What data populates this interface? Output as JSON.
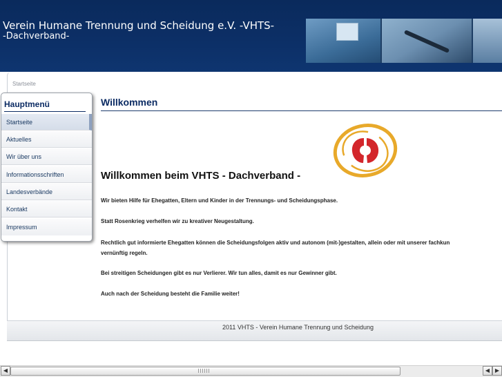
{
  "header": {
    "title": "Verein Humane Trennung und Scheidung e.V. -VHTS-",
    "subtitle": "-Dachverband-"
  },
  "breadcrumb": "Startseite",
  "sidebar": {
    "title": "Hauptmenü",
    "items": [
      {
        "label": "Startseite",
        "active": true
      },
      {
        "label": "Aktuelles"
      },
      {
        "label": "Wir über uns"
      },
      {
        "label": "Informationsschriften"
      },
      {
        "label": "Landesverbände"
      },
      {
        "label": "Kontakt"
      },
      {
        "label": "Impressum"
      }
    ]
  },
  "main": {
    "heading": "Willkommen",
    "welcome": "Willkommen beim VHTS - Dachverband -",
    "paragraphs": [
      "Wir bieten Hilfe für Ehegatten, Eltern und Kinder in der Trennungs- und Scheidungsphase.",
      "Statt Rosenkrieg verhelfen wir zu kreativer Neugestaltung.",
      "Rechtlich gut informierte Ehegatten können die Scheidungsfolgen aktiv und autonom (mit-)gestalten, allein oder mit unserer fachkun",
      "vernünftig regeln.",
      "Bei streitigen Scheidungen gibt es nur Verlierer. Wir tun alles, damit es nur Gewinner gibt.",
      "Auch nach der Scheidung besteht die Familie weiter!"
    ]
  },
  "footer": "2011 VHTS - Verein Humane Trennung und Scheidung",
  "colors": {
    "header_bg": "#0c2f66",
    "heading": "#0b2b63",
    "logo_ring": "#e8a92a",
    "logo_red": "#d3262b"
  },
  "scrollbar": {
    "left_arrow": "◀",
    "right_arrow": "▶"
  }
}
